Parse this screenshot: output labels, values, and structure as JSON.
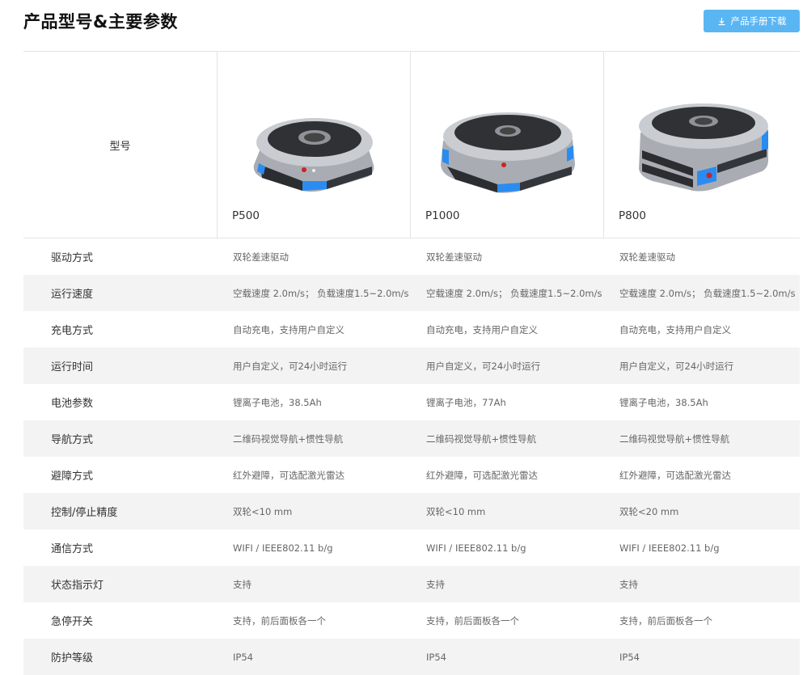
{
  "title": "产品型号&主要参数",
  "download": {
    "label": "产品手册下载",
    "icon": "download-icon"
  },
  "header": {
    "label": "型号",
    "products": [
      {
        "name": "P500"
      },
      {
        "name": "P1000"
      },
      {
        "name": "P800"
      }
    ]
  },
  "specs": [
    {
      "label": "驱动方式",
      "values": [
        "双轮差速驱动",
        "双轮差速驱动",
        "双轮差速驱动"
      ]
    },
    {
      "label": "运行速度",
      "values": [
        "空载速度 2.0m/s； 负载速度1.5~2.0m/s",
        "空载速度 2.0m/s； 负载速度1.5~2.0m/s",
        "空载速度 2.0m/s； 负载速度1.5~2.0m/s"
      ]
    },
    {
      "label": "充电方式",
      "values": [
        "自动充电，支持用户自定义",
        "自动充电，支持用户自定义",
        "自动充电，支持用户自定义"
      ]
    },
    {
      "label": "运行时间",
      "values": [
        "用户自定义，可24小时运行",
        "用户自定义，可24小时运行",
        "用户自定义，可24小时运行"
      ]
    },
    {
      "label": "电池参数",
      "values": [
        "锂离子电池，38.5Ah",
        "锂离子电池，77Ah",
        "锂离子电池，38.5Ah"
      ]
    },
    {
      "label": "导航方式",
      "values": [
        "二维码视觉导航+惯性导航",
        "二维码视觉导航+惯性导航",
        "二维码视觉导航+惯性导航"
      ]
    },
    {
      "label": "避障方式",
      "values": [
        "红外避障，可选配激光雷达",
        "红外避障，可选配激光雷达",
        "红外避障，可选配激光雷达"
      ]
    },
    {
      "label": "控制/停止精度",
      "values": [
        "双轮<10 mm",
        "双轮<10 mm",
        "双轮<20 mm"
      ]
    },
    {
      "label": "通信方式",
      "values": [
        "WIFI / IEEE802.11 b/g",
        "WIFI / IEEE802.11 b/g",
        "WIFI / IEEE802.11 b/g"
      ]
    },
    {
      "label": "状态指示灯",
      "values": [
        "支持",
        "支持",
        "支持"
      ]
    },
    {
      "label": "急停开关",
      "values": [
        "支持，前后面板各一个",
        "支持，前后面板各一个",
        "支持，前后面板各一个"
      ]
    },
    {
      "label": "防护等级",
      "values": [
        "IP54",
        "IP54",
        "IP54"
      ]
    }
  ],
  "colors": {
    "button": "#5ab6f3",
    "accent_blue": "#2a8cf0",
    "stripe": "#f3f3f3"
  }
}
